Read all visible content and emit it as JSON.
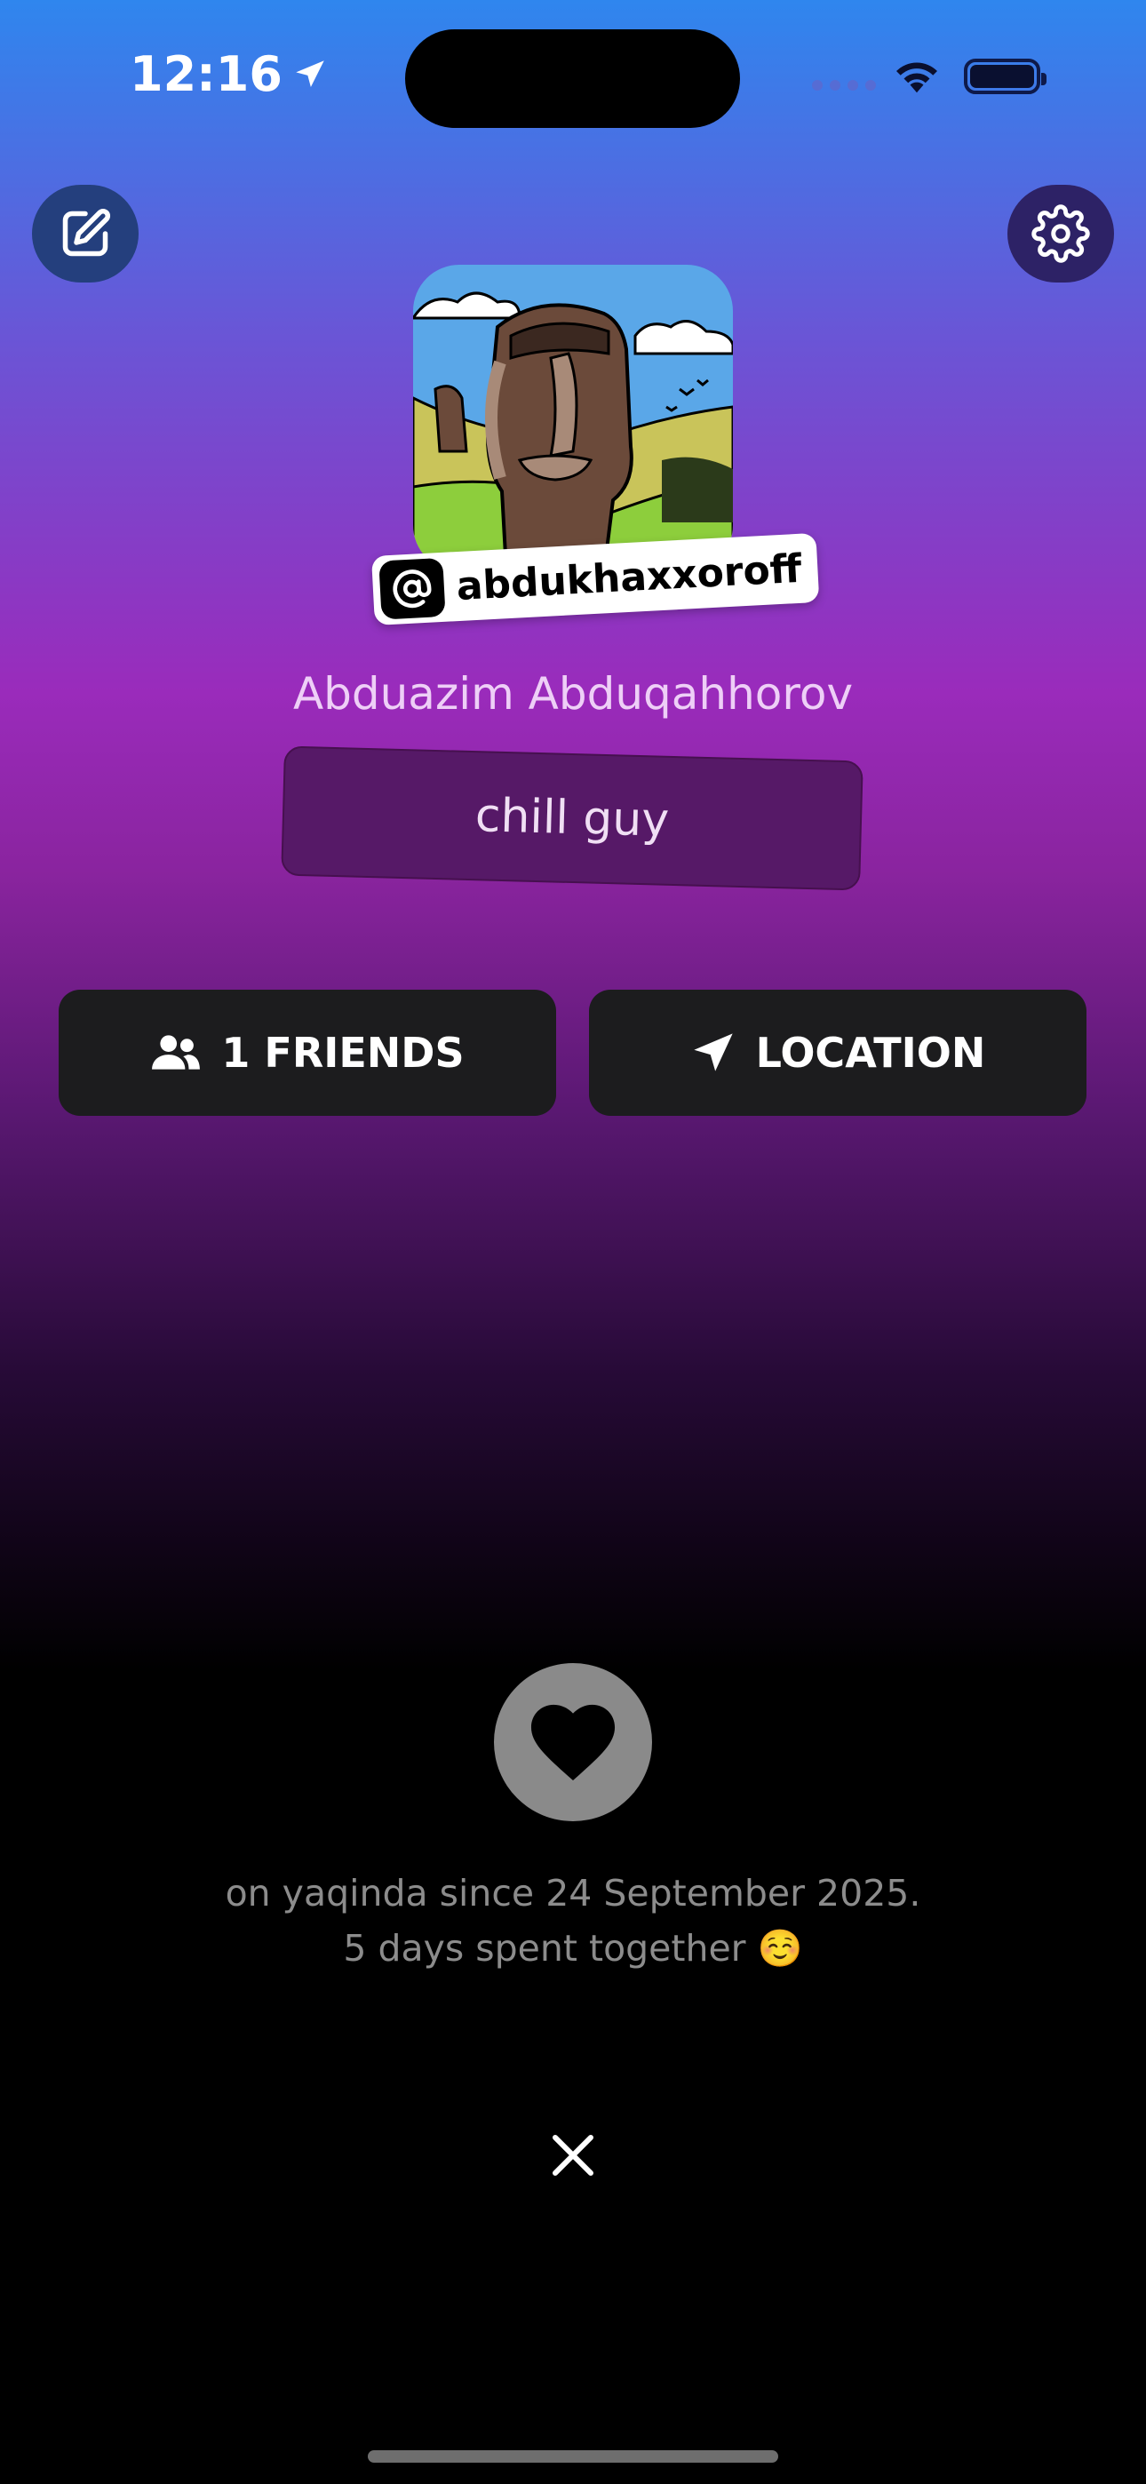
{
  "status_bar": {
    "time": "12:16"
  },
  "profile": {
    "handle": "abdukhaxxoroff",
    "full_name": "Abduazim Abduqahhorov",
    "bio": "chill guy"
  },
  "actions": {
    "friends_label": "1 FRIENDS",
    "location_label": "LOCATION"
  },
  "footer": {
    "since_line1": "on yaqinda since 24 September 2025.",
    "since_line2": "5 days spent together ☺️"
  },
  "icons": [
    "location-arrow-icon",
    "wifi-icon",
    "battery-icon",
    "edit-icon",
    "gear-icon",
    "at-icon",
    "users-icon",
    "navigation-arrow-icon",
    "heart-icon",
    "close-icon"
  ],
  "colors": {
    "card": "#1c1c1e",
    "bio_bg": "#561967",
    "muted_text": "#8c8c8c"
  }
}
